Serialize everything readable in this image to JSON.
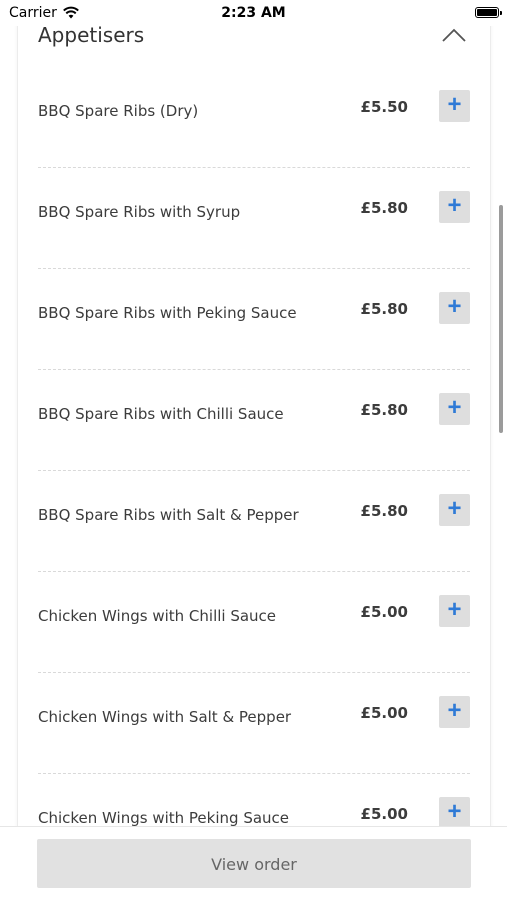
{
  "status_bar": {
    "carrier": "Carrier",
    "time": "2:23 AM"
  },
  "section": {
    "title": "Appetisers"
  },
  "items": [
    {
      "name": "BBQ Spare Ribs (Dry)",
      "price": "£5.50",
      "add": "+"
    },
    {
      "name": "BBQ Spare Ribs with Syrup",
      "price": "£5.80",
      "add": "+"
    },
    {
      "name": "BBQ Spare Ribs with Peking Sauce",
      "price": "£5.80",
      "add": "+"
    },
    {
      "name": "BBQ Spare Ribs with Chilli Sauce",
      "price": "£5.80",
      "add": "+"
    },
    {
      "name": "BBQ Spare Ribs with Salt & Pepper",
      "price": "£5.80",
      "add": "+"
    },
    {
      "name": "Chicken Wings with Chilli Sauce",
      "price": "£5.00",
      "add": "+"
    },
    {
      "name": "Chicken Wings with Salt & Pepper",
      "price": "£5.00",
      "add": "+"
    },
    {
      "name": "Chicken Wings with Peking Sauce",
      "price": "£5.00",
      "add": "+"
    }
  ],
  "footer": {
    "view_order_label": "View order"
  },
  "colors": {
    "accent": "#2f7ad6",
    "button_bg": "#dedede",
    "footer_button_bg": "#e1e1e1"
  }
}
